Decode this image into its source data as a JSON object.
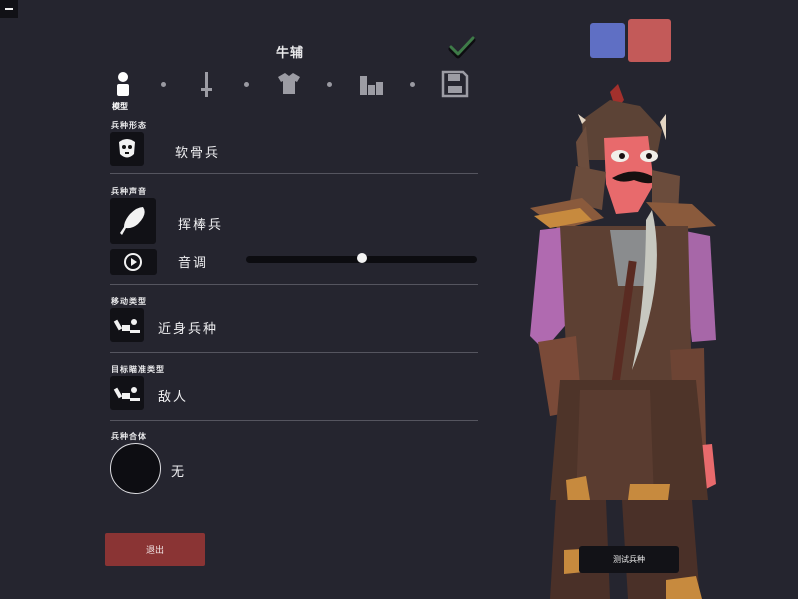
{
  "header": {
    "unit_name": "牛辅"
  },
  "tabs": {
    "active_label": "模型",
    "items": [
      "model-icon",
      "sword-icon",
      "shirt-icon",
      "stats-icon",
      "save-icon"
    ]
  },
  "sections": {
    "form": {
      "label": "兵种形态",
      "value": "软骨兵"
    },
    "voice": {
      "label": "兵种声音",
      "value": "挥棒兵",
      "pitch_label": "音调",
      "pitch_value": 0.5
    },
    "movement": {
      "label": "移动类型",
      "value": "近身兵种"
    },
    "targeting": {
      "label": "目标瞄准类型",
      "value": "敌人"
    },
    "mount": {
      "label": "兵种合体",
      "value": "无"
    }
  },
  "buttons": {
    "exit": "退出",
    "test_unit": "测试兵种"
  },
  "colors": {
    "team_blue": "#5f6fc4",
    "team_red": "#c35a59",
    "exit_button": "#8a3434"
  }
}
